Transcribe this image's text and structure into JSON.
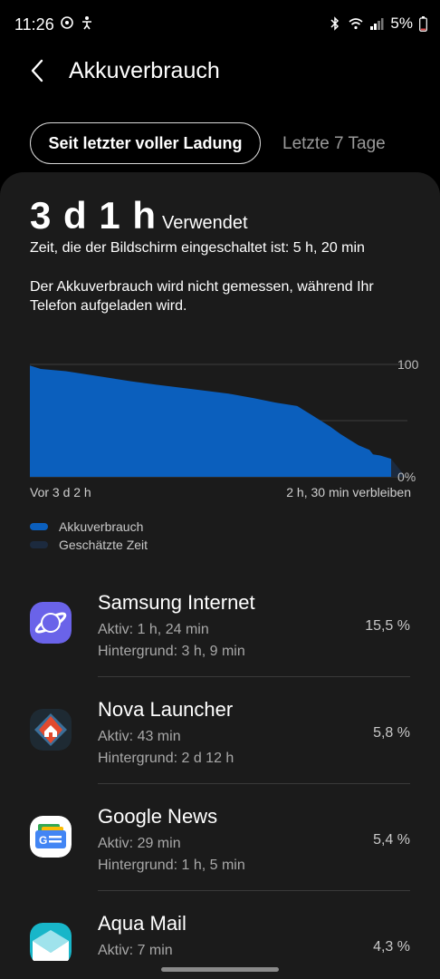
{
  "status_bar": {
    "time": "11:26",
    "battery": "5%",
    "icons": [
      "sync-icon",
      "accessibility-icon",
      "bluetooth-icon",
      "wifi-icon",
      "signal-icon",
      "battery-icon"
    ]
  },
  "app_bar": {
    "title": "Akkuverbrauch",
    "back_icon": "back-arrow-icon"
  },
  "tabs": [
    {
      "label": "Seit letzter voller Ladung",
      "active": true
    },
    {
      "label": "Letzte 7 Tage",
      "active": false
    }
  ],
  "summary": {
    "usage_value": "3 d 1 h",
    "usage_label": "Verwendet",
    "screen_time": "Zeit, die der Bildschirm eingeschaltet ist: 5 h, 20 min",
    "note": "Der Akkuverbrauch wird nicht gemessen, während Ihr Telefon aufgeladen wird."
  },
  "chart_data": {
    "type": "area",
    "y_tick_top": "100",
    "y_tick_bottom": "0%",
    "ylim": [
      0,
      100
    ],
    "x_label_left": "Vor 3 d 2 h",
    "x_label_right": "2 h, 30 min verbleiben",
    "series": [
      {
        "name": "Akkuverbrauch",
        "color": "#0b5fbd",
        "x": [
          0,
          3,
          10,
          20,
          28,
          35,
          45,
          55,
          62,
          68,
          74,
          78,
          83,
          86,
          88,
          91,
          94,
          95,
          97,
          100
        ],
        "values": [
          99,
          96,
          94,
          89,
          85,
          82,
          78,
          74,
          70,
          66,
          63,
          55,
          45,
          38,
          34,
          28,
          24,
          20,
          19,
          16
        ]
      },
      {
        "name": "Geschätzte Zeit",
        "color": "#1c2a3e",
        "x": [
          100,
          104
        ],
        "values": [
          16,
          0
        ]
      }
    ],
    "grid": true
  },
  "legend": [
    {
      "label": "Akkuverbrauch",
      "color": "#0b5fbd"
    },
    {
      "label": "Geschätzte Zeit",
      "color": "#1c2a3e"
    }
  ],
  "apps": [
    {
      "name": "Samsung Internet",
      "active": "Aktiv: 1 h, 24 min",
      "background": "Hintergrund: 3 h, 9 min",
      "percent": "15,5 %",
      "icon": "samsung-internet-icon"
    },
    {
      "name": "Nova Launcher",
      "active": "Aktiv: 43 min",
      "background": "Hintergrund: 2 d 12 h",
      "percent": "5,8 %",
      "icon": "nova-launcher-icon"
    },
    {
      "name": "Google News",
      "active": "Aktiv: 29 min",
      "background": "Hintergrund: 1 h, 5 min",
      "percent": "5,4 %",
      "icon": "google-news-icon"
    },
    {
      "name": "Aqua Mail",
      "active": "Aktiv: 7 min",
      "background": "",
      "percent": "4,3 %",
      "icon": "aqua-mail-icon"
    }
  ]
}
